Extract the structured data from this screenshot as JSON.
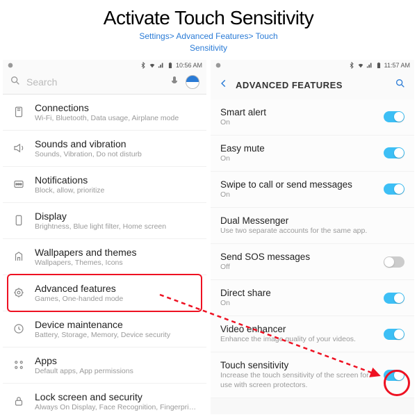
{
  "title": "Activate Touch Sensitivity",
  "breadcrumb_line1": "Settings> Advanced Features> Touch",
  "breadcrumb_line2": "Sensitivity",
  "left": {
    "statusbar": {
      "time": "10:56 AM"
    },
    "search_placeholder": "Search",
    "items": [
      {
        "title": "Connections",
        "sub": "Wi-Fi, Bluetooth, Data usage, Airplane mode",
        "icon": "connections-icon"
      },
      {
        "title": "Sounds and vibration",
        "sub": "Sounds, Vibration, Do not disturb",
        "icon": "sound-icon"
      },
      {
        "title": "Notifications",
        "sub": "Block, allow, prioritize",
        "icon": "notifications-icon"
      },
      {
        "title": "Display",
        "sub": "Brightness, Blue light filter, Home screen",
        "icon": "display-icon"
      },
      {
        "title": "Wallpapers and themes",
        "sub": "Wallpapers, Themes, Icons",
        "icon": "wallpaper-icon"
      },
      {
        "title": "Advanced features",
        "sub": "Games, One-handed mode",
        "icon": "advanced-icon",
        "highlight": true
      },
      {
        "title": "Device maintenance",
        "sub": "Battery, Storage, Memory, Device security",
        "icon": "maintenance-icon"
      },
      {
        "title": "Apps",
        "sub": "Default apps, App permissions",
        "icon": "apps-icon"
      },
      {
        "title": "Lock screen and security",
        "sub": "Always On Display, Face Recognition, Fingerprints, Iris",
        "icon": "lock-icon"
      }
    ]
  },
  "right": {
    "statusbar": {
      "time": "11:57 AM"
    },
    "header": "ADVANCED FEATURES",
    "items": [
      {
        "title": "Smart alert",
        "sub": "On",
        "toggle": "on"
      },
      {
        "title": "Easy mute",
        "sub": "On",
        "toggle": "on"
      },
      {
        "title": "Swipe to call or send messages",
        "sub": "On",
        "toggle": "on"
      },
      {
        "title": "Dual Messenger",
        "sub": "Use two separate accounts for the same app.",
        "toggle": null
      },
      {
        "title": "Send SOS messages",
        "sub": "Off",
        "toggle": "off"
      },
      {
        "title": "Direct share",
        "sub": "On",
        "toggle": "on"
      },
      {
        "title": "Video enhancer",
        "sub": "Enhance the image quality of your videos.",
        "toggle": "on"
      },
      {
        "title": "Touch sensitivity",
        "sub": "Increase the touch sensitivity of the screen for use with screen protectors.",
        "toggle": "on",
        "circled": true
      }
    ]
  },
  "colors": {
    "accent": "#3dbff5",
    "highlight": "#e12",
    "link": "#2a7bd6"
  }
}
